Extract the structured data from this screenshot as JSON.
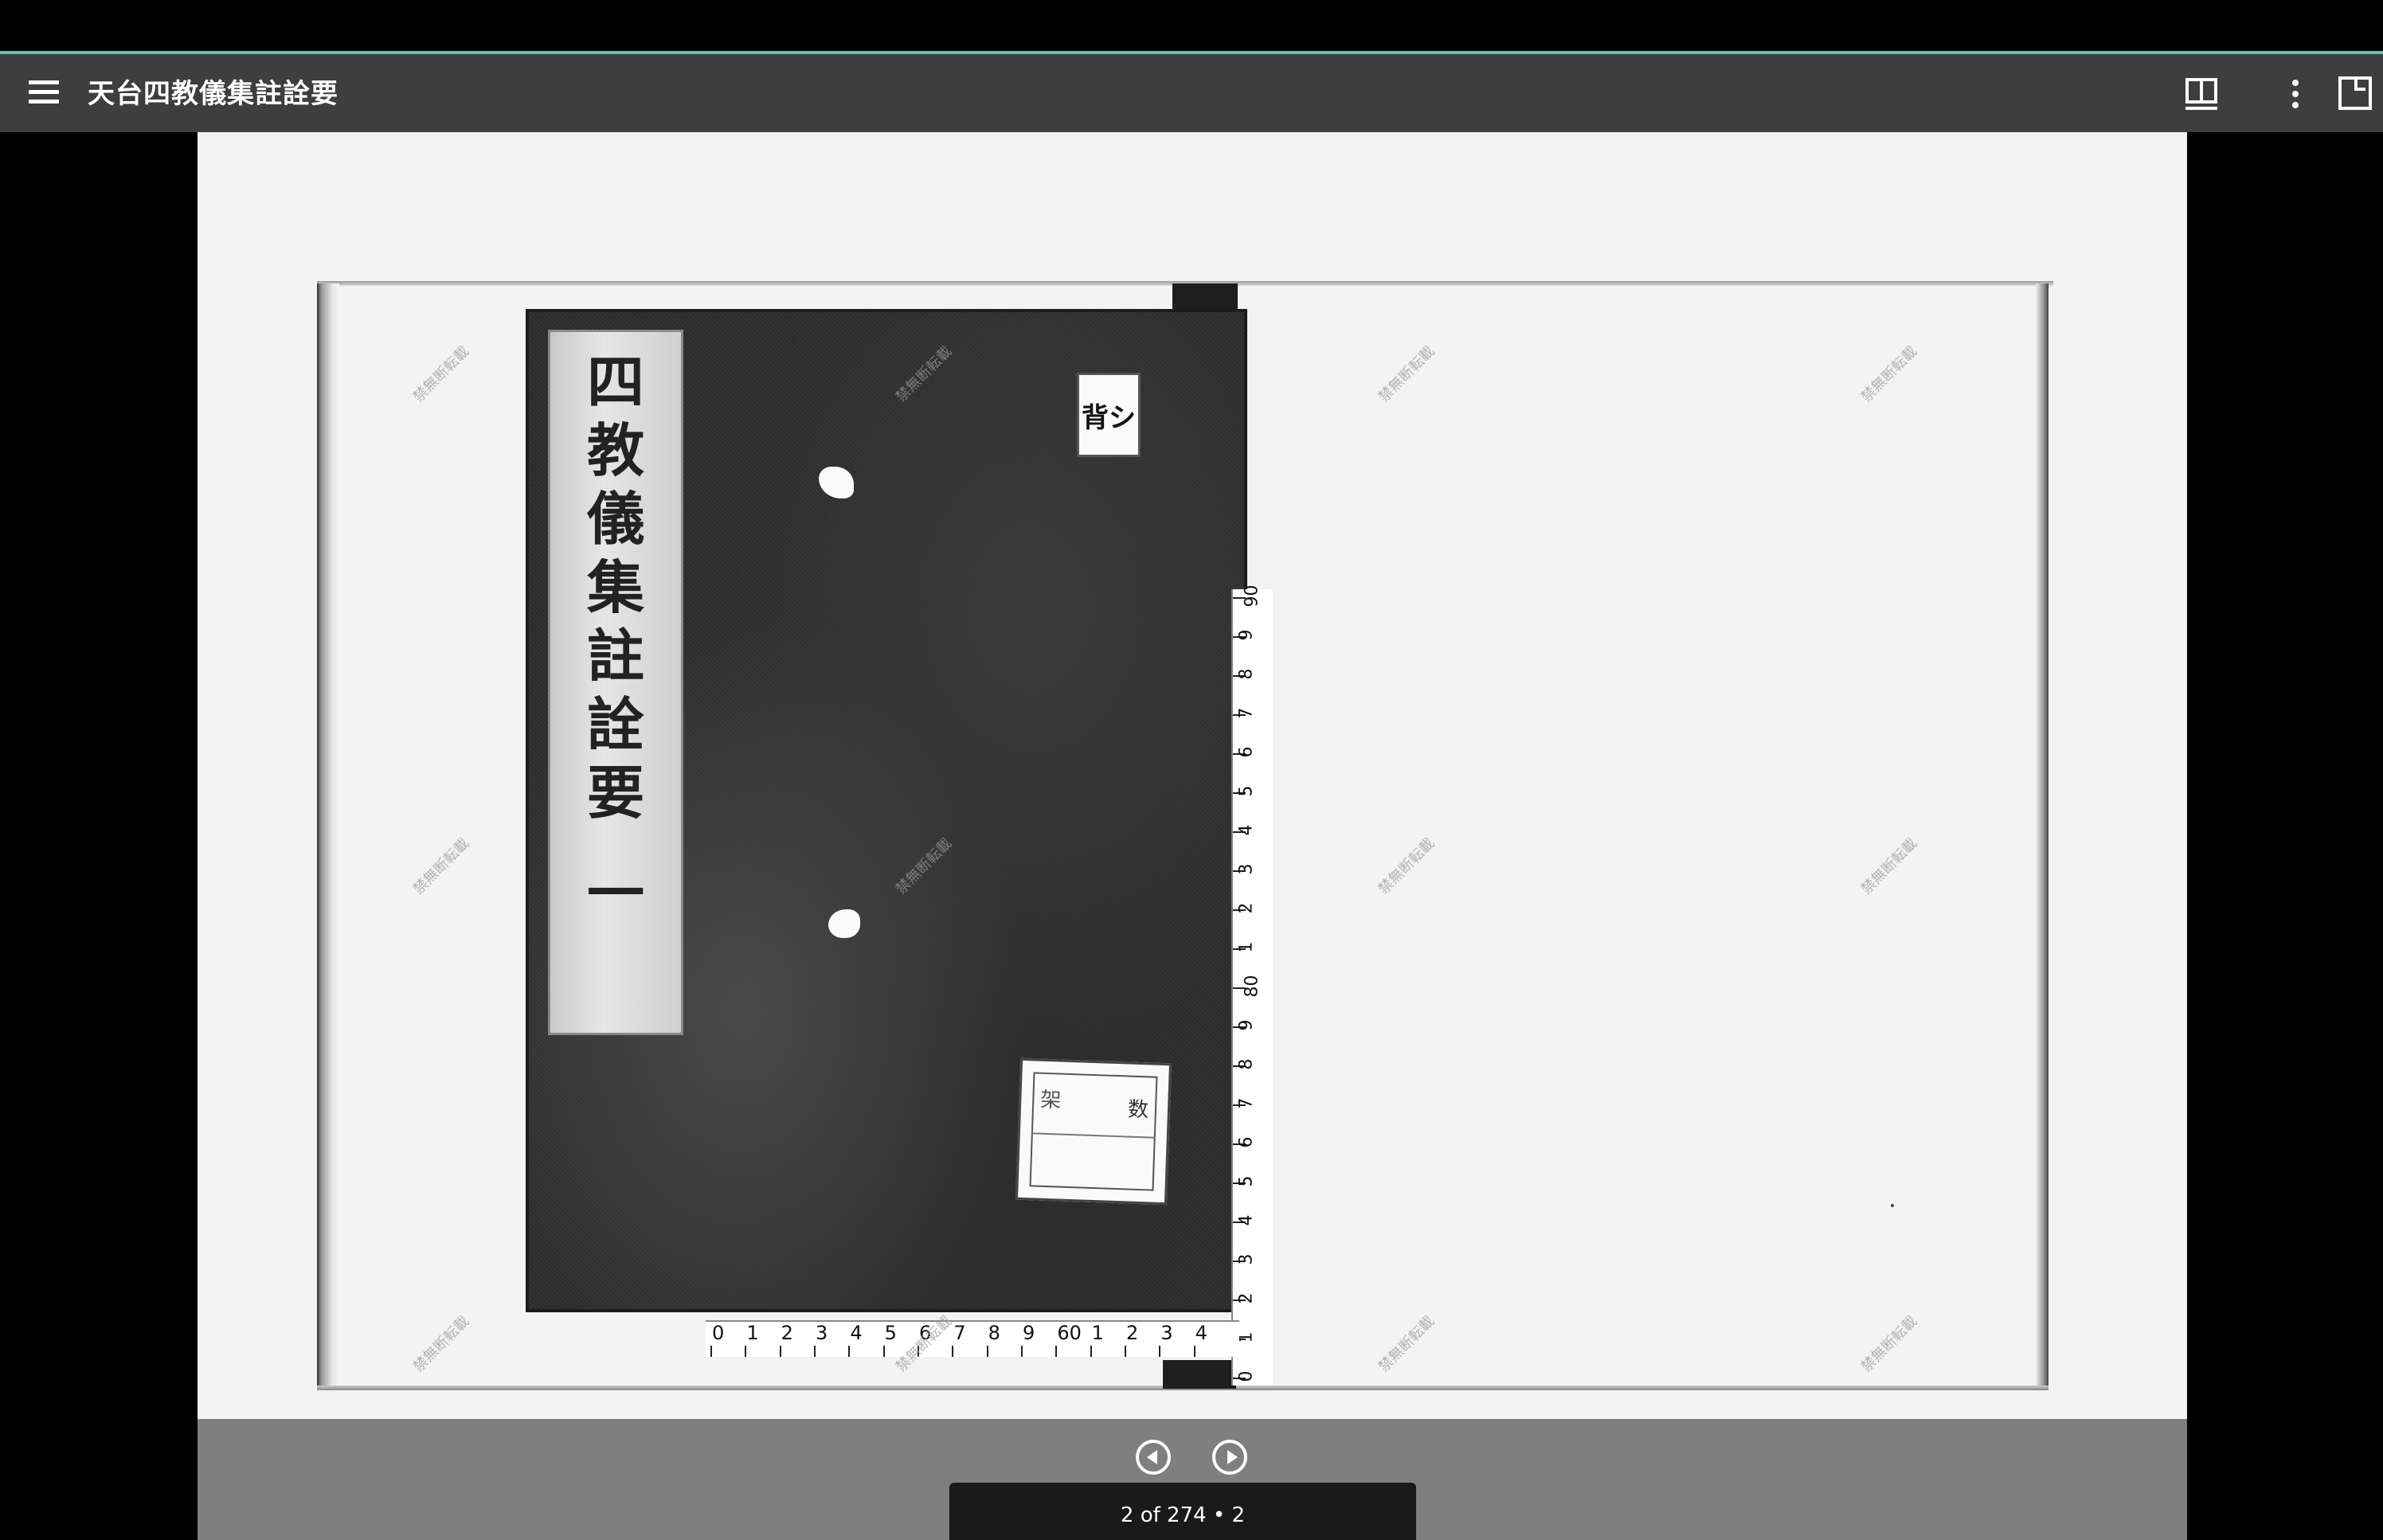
{
  "app": {
    "title": "天台四教儀集註詮要"
  },
  "document": {
    "slip_title_chars": [
      "四",
      "教",
      "儀",
      "集",
      "註",
      "詮",
      "要",
      "一"
    ],
    "label_top_text": "背シ",
    "label_bottom": {
      "left_char": "架",
      "right_char": "数"
    },
    "watermark_text": "禁無断転載",
    "ruler_vertical_labels": [
      "90",
      "9",
      "8",
      "7",
      "6",
      "5",
      "4",
      "3",
      "2",
      "1",
      "80",
      "9",
      "8",
      "7",
      "6",
      "5",
      "4",
      "3",
      "2",
      "1",
      "0"
    ],
    "ruler_horizontal_labels": [
      "0",
      "1",
      "2",
      "3",
      "4",
      "5",
      "6",
      "7",
      "8",
      "9",
      "60",
      "1",
      "2",
      "3",
      "4"
    ]
  },
  "navigation": {
    "page_indicator": "2 of 274 • 2"
  },
  "icons": {
    "menu": "menu-icon",
    "book_view": "book-view-icon",
    "more": "more-vert-icon",
    "fullscreen": "fullscreen-icon",
    "prev": "prev-page-icon",
    "next": "next-page-icon"
  }
}
